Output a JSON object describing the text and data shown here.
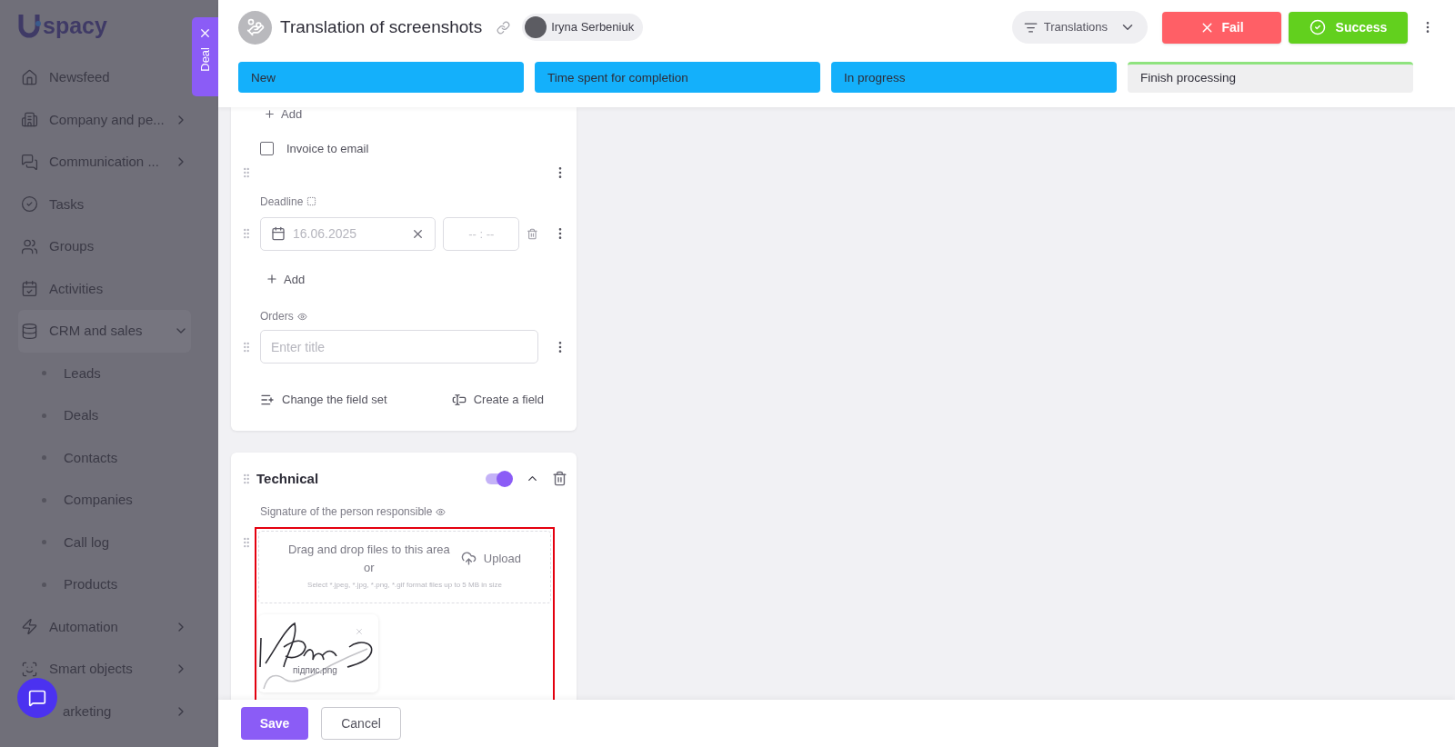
{
  "sidebar": {
    "logo_text": "spacy",
    "items": [
      {
        "label": "Newsfeed"
      },
      {
        "label": "Company and pe...",
        "expanded": false
      },
      {
        "label": "Communication ...",
        "expanded": false
      },
      {
        "label": "Tasks"
      },
      {
        "label": "Groups"
      },
      {
        "label": "Activities"
      },
      {
        "label": "CRM and sales",
        "expanded": true,
        "children": [
          {
            "label": "Leads"
          },
          {
            "label": "Deals"
          },
          {
            "label": "Contacts"
          },
          {
            "label": "Companies"
          },
          {
            "label": "Call log"
          },
          {
            "label": "Products"
          }
        ]
      },
      {
        "label": "Automation",
        "expanded": false
      },
      {
        "label": "Smart objects",
        "expanded": false
      },
      {
        "label": "arketing",
        "expanded": false
      }
    ]
  },
  "side_tab": {
    "label": "Deal"
  },
  "header": {
    "title": "Translation of screenshots",
    "responsible": "Iryna Serbeniuk",
    "pipeline": "Translations",
    "fail_button": "Fail",
    "success_button": "Success",
    "stages": [
      {
        "label": "New",
        "passed": true,
        "color": "#14b0fb"
      },
      {
        "label": "Time spent for completion",
        "passed": true,
        "color": "#14b0fb"
      },
      {
        "label": "In progress",
        "passed": true,
        "color": "#14b0fb"
      },
      {
        "label": "Finish processing",
        "passed": false,
        "color": "#8fe37f"
      }
    ]
  },
  "main_card": {
    "top_add": "Add",
    "invoice_checkbox": {
      "label": "Invoice to email",
      "checked": false
    },
    "deadline": {
      "label": "Deadline",
      "date": "16.06.2025",
      "time_placeholder": "-- : --",
      "add": "Add"
    },
    "orders": {
      "label": "Orders",
      "placeholder": "Enter title"
    },
    "change_field_set": "Change the field set",
    "create_field": "Create a field"
  },
  "technical_card": {
    "title": "Technical",
    "on": true,
    "expanded": true,
    "field_label": "Signature of the person responsible",
    "upload": {
      "drop_text": "Drag and drop files to this area",
      "or": "or",
      "button": "Upload",
      "hint": "Select *.jpeg, *.jpg, *.png, *.gif format files up to 5 MB in size"
    },
    "file": {
      "name": "підпис.png"
    }
  },
  "footer": {
    "save": "Save",
    "cancel": "Cancel"
  }
}
